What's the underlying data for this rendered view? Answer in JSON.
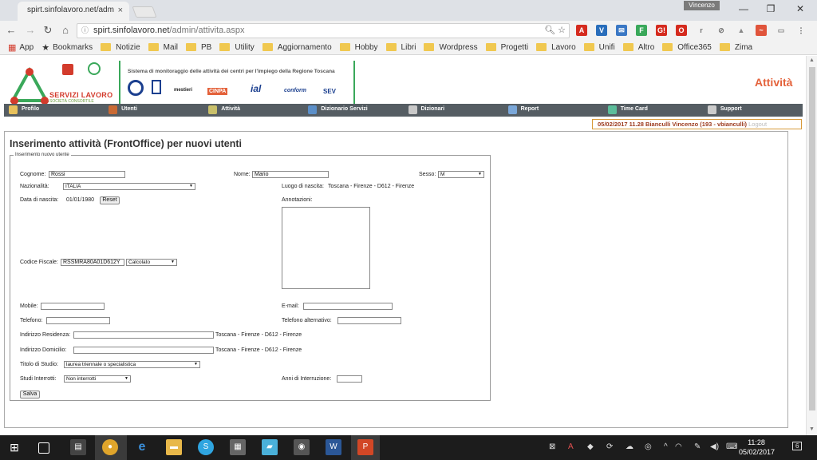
{
  "browser": {
    "tab_title": "spirt.sinfolavoro.net/adm",
    "tab_close": "×",
    "user_badge": "Vincenzo",
    "window_controls": [
      "—",
      "❐",
      "✕"
    ],
    "url_domain": "spirt.sinfolavoro.net",
    "url_path": "/admin/attivita.aspx",
    "extensions": [
      {
        "icon": "acrobat-icon",
        "glyph": "A",
        "color": "#d52b1e"
      },
      {
        "icon": "v-icon",
        "glyph": "V",
        "color": "#2a6ebb"
      },
      {
        "icon": "cart-icon",
        "glyph": "✉",
        "color": "#3b78c4"
      },
      {
        "icon": "f-icon",
        "glyph": "F",
        "color": "#3aa85a"
      },
      {
        "icon": "g-icon",
        "glyph": "G!",
        "color": "#d52b1e"
      },
      {
        "icon": "opera-icon",
        "glyph": "O",
        "color": "#d52b1e"
      },
      {
        "icon": "r-icon",
        "glyph": "r",
        "color": "#777"
      },
      {
        "icon": "eye-off-icon",
        "glyph": "⊘",
        "color": "#777"
      },
      {
        "icon": "triangle-icon",
        "glyph": "▲",
        "color": "#888"
      },
      {
        "icon": "wave-icon",
        "glyph": "~",
        "color": "#e0543b"
      },
      {
        "icon": "cast-icon",
        "glyph": "▭",
        "color": "#888"
      },
      {
        "icon": "menu-icon",
        "glyph": "⋮",
        "color": "#555"
      }
    ]
  },
  "bookmarks": [
    {
      "label": "App",
      "icon": "apps-grid-icon"
    },
    {
      "label": "Bookmarks",
      "icon": "star-icon"
    },
    {
      "label": "Notizie",
      "icon": "folder-icon"
    },
    {
      "label": "Mail",
      "icon": "folder-icon"
    },
    {
      "label": "PB",
      "icon": "folder-icon"
    },
    {
      "label": "Utility",
      "icon": "folder-icon"
    },
    {
      "label": "Aggiornamento",
      "icon": "folder-icon"
    },
    {
      "label": "Hobby",
      "icon": "folder-icon"
    },
    {
      "label": "Libri",
      "icon": "folder-icon"
    },
    {
      "label": "Wordpress",
      "icon": "folder-icon"
    },
    {
      "label": "Progetti",
      "icon": "folder-icon"
    },
    {
      "label": "Lavoro",
      "icon": "folder-icon"
    },
    {
      "label": "Unifi",
      "icon": "folder-icon"
    },
    {
      "label": "Altro",
      "icon": "folder-icon"
    },
    {
      "label": "Office365",
      "icon": "folder-icon"
    },
    {
      "label": "Zima",
      "icon": "folder-icon"
    }
  ],
  "header": {
    "brand": "SERVIZI LAVORO",
    "brand_sub": "SOCIETÀ CONSORTILE",
    "sponsor_title": "Sistema di monitoraggio delle attività dei centri per l'impiego della Regione Toscana",
    "sponsors": [
      "mestieri",
      "CINPA",
      "ial",
      "conform",
      "SEV"
    ],
    "page_title": "Attività"
  },
  "menu": [
    {
      "label": "Profilo",
      "icon": "user-icon",
      "color": "#e7c15b"
    },
    {
      "label": "Utenti",
      "icon": "users-icon",
      "color": "#c96a34"
    },
    {
      "label": "Attività",
      "icon": "activity-icon",
      "color": "#c9c06a"
    },
    {
      "label": "Dizionario Servizi",
      "icon": "gears-icon",
      "color": "#5b8fc9"
    },
    {
      "label": "Dizionari",
      "icon": "table-icon",
      "color": "#c9c9c9"
    },
    {
      "label": "Report",
      "icon": "report-icon",
      "color": "#7aa7d9"
    },
    {
      "label": "Time Card",
      "icon": "clock-icon",
      "color": "#5bbd9a"
    },
    {
      "label": "Support",
      "icon": "support-icon",
      "color": "#cccccc"
    }
  ],
  "userbar": {
    "text": "05/02/2017 11.28 Bianculli Vincenzo (193 - vbianculli)",
    "logout": "Logout"
  },
  "form": {
    "title": "Inserimento attività (FrontOffice) per nuovi utenti",
    "legend": "Inserimento nuovo utente",
    "cognome_label": "Cognome:",
    "cognome_value": "Rossi",
    "nome_label": "Nome:",
    "nome_value": "Mario",
    "sesso_label": "Sesso:",
    "sesso_value": "M",
    "nazionalita_label": "Nazionalità:",
    "nazionalita_value": "ITALIA",
    "luogo_label": "Luogo di nascita:",
    "luogo_value": "Toscana - Firenze - D612 - Firenze",
    "data_label": "Data di nascita:",
    "data_value": "01/01/1980",
    "reset_label": "Reset",
    "annotazioni_label": "Annotazioni:",
    "cf_label": "Codice Fiscale:",
    "cf_value": "RSSMRA80A01D612Y",
    "cf_mode": "Calcolato",
    "mobile_label": "Mobile:",
    "email_label": "E-mail:",
    "telefono_label": "Telefono:",
    "telefono_alt_label": "Telefono alternativo:",
    "residenza_label": "Indirizzo Residenza:",
    "residenza_place": "Toscana - Firenze - D612 - Firenze",
    "domicilio_label": "Indirizzo Domicilio:",
    "domicilio_place": "Toscana - Firenze - D612 - Firenze",
    "titolo_label": "Titolo di Studio:",
    "titolo_value": "laurea triennale o specialistica",
    "studi_label": "Studi Interrotti:",
    "studi_value": "Non interrotti",
    "anni_label": "Anni di Interruzione:",
    "salva_label": "Salva"
  },
  "taskbar": {
    "time": "11:28",
    "date": "05/02/2017",
    "notifications": "6"
  }
}
